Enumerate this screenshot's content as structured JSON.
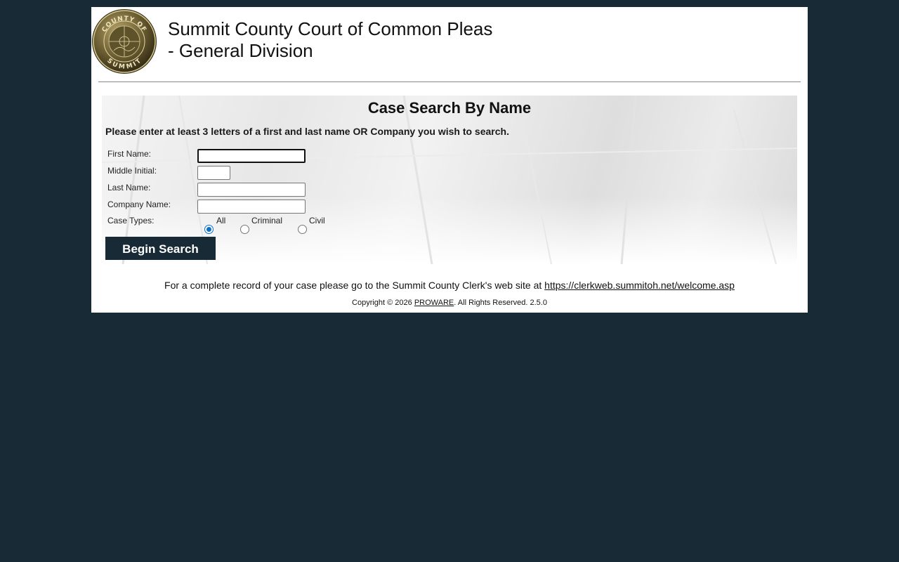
{
  "header": {
    "title_line1": "Summit County Court of Common Pleas",
    "title_line2": "- General Division",
    "seal_text_top": "COUNTY OF",
    "seal_text_bottom": "SUMMIT"
  },
  "search": {
    "title": "Case Search By Name",
    "instructions": "Please enter at least 3 letters of a first and last name OR Company you wish to search.",
    "fields": {
      "first_name": {
        "label": "First Name:",
        "value": ""
      },
      "middle_initial": {
        "label": "Middle Initial:",
        "value": ""
      },
      "last_name": {
        "label": "Last Name:",
        "value": ""
      },
      "company_name": {
        "label": "Company Name:",
        "value": ""
      }
    },
    "case_types": {
      "label": "Case Types:",
      "options": [
        "All",
        "Criminal",
        "Civil"
      ],
      "selected": "All"
    },
    "button_label": "Begin Search"
  },
  "footer": {
    "record_text": "For a complete record of your case please go to the Summit County Clerk's web site at",
    "record_link": "https://clerkweb.summitoh.net/welcome.asp",
    "copyright_prefix": "Copyright © 2026",
    "company_link": "PROWARE",
    "copyright_suffix": ". All Rights Reserved. 2.5.0"
  },
  "colors": {
    "page_background": "#182a36",
    "button_background": "#182a36",
    "radio_selected": "#0f6fc6"
  }
}
